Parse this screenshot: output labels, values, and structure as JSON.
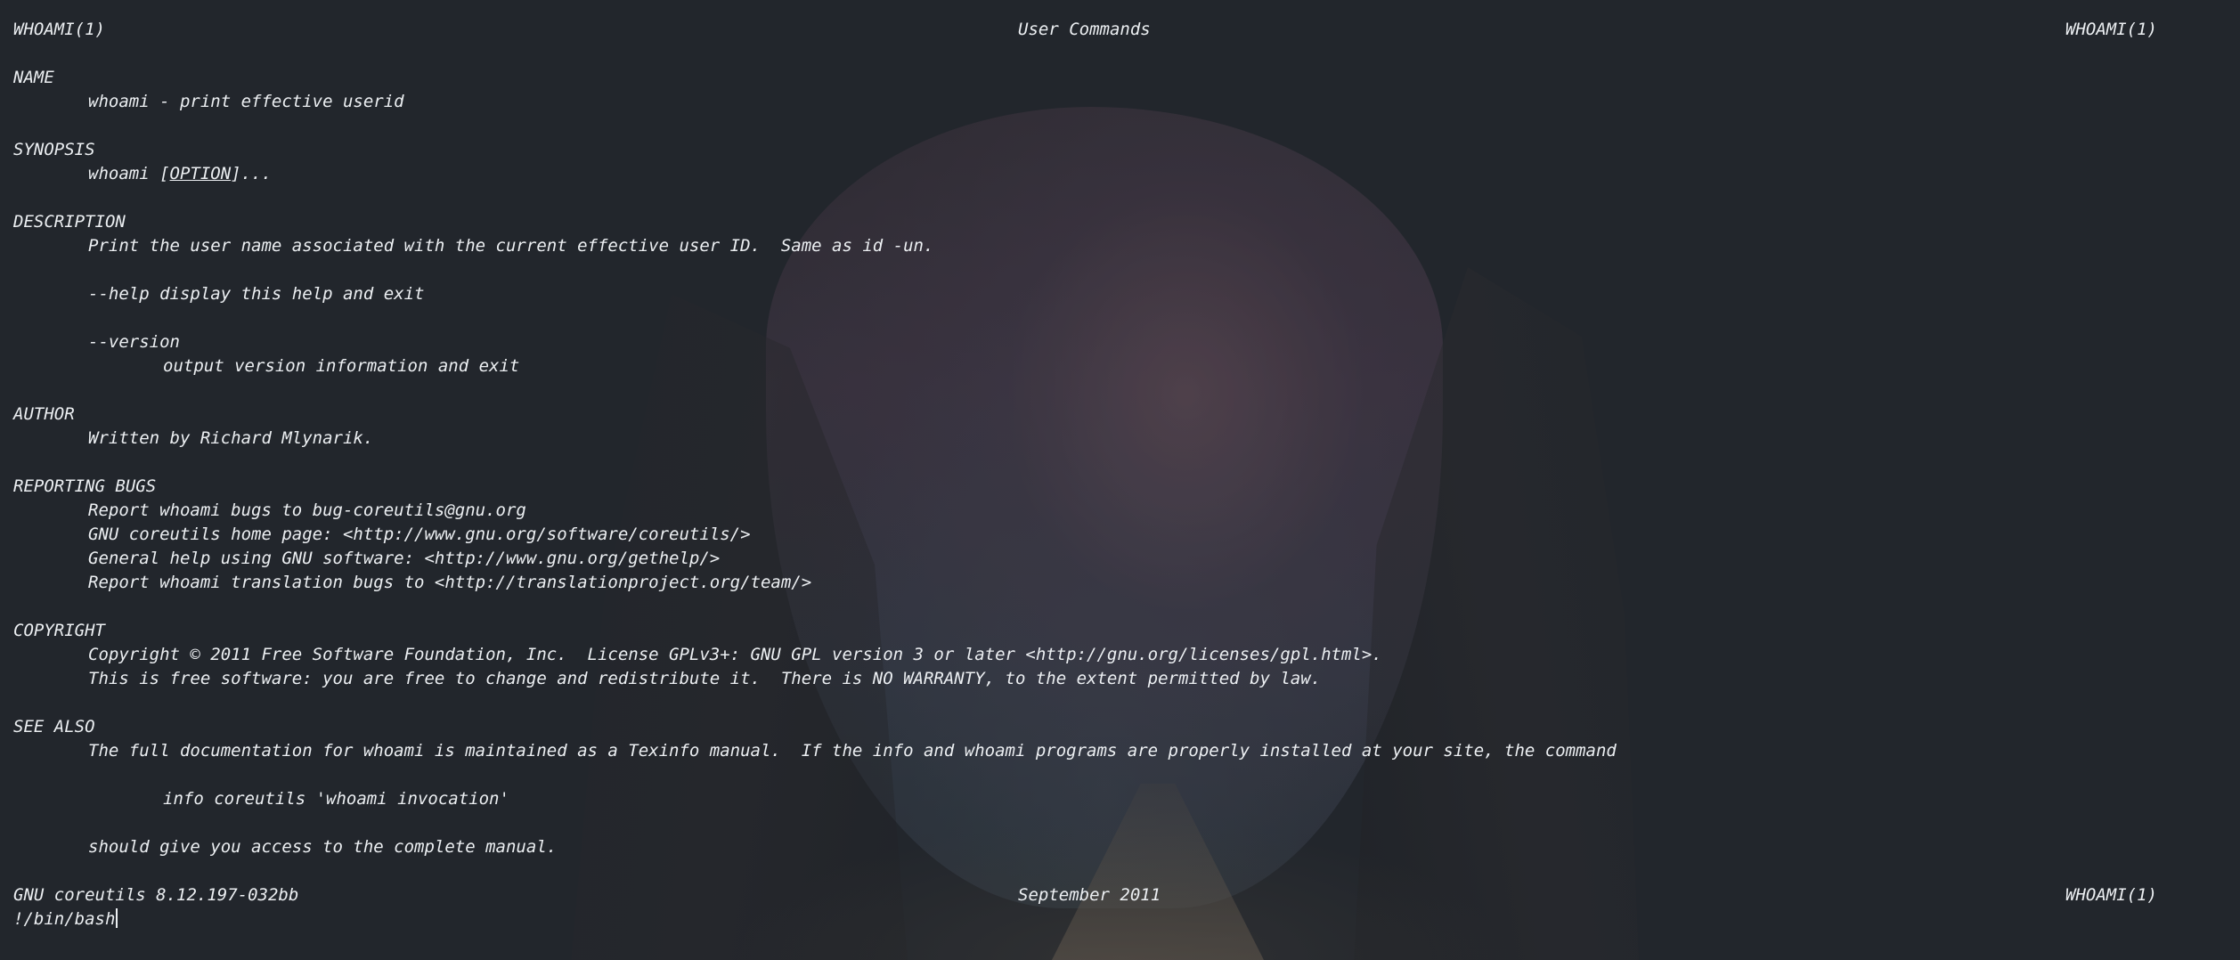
{
  "header": {
    "left": "WHOAMI(1)",
    "center": "User Commands",
    "right": "WHOAMI(1)"
  },
  "sections": {
    "name": {
      "heading": "NAME",
      "text": "whoami - print effective userid"
    },
    "synopsis": {
      "heading": "SYNOPSIS",
      "cmd": "whoami [",
      "option": "OPTION",
      "rest": "]..."
    },
    "description": {
      "heading": "DESCRIPTION",
      "text": "Print the user name associated with the current effective user ID.  Same as id -un.",
      "help": "--help display this help and exit",
      "version_flag": "--version",
      "version_desc": "output version information and exit"
    },
    "author": {
      "heading": "AUTHOR",
      "text": "Written by Richard Mlynarik."
    },
    "reporting_bugs": {
      "heading": "REPORTING BUGS",
      "lines": [
        "Report whoami bugs to bug-coreutils@gnu.org",
        "GNU coreutils home page: <http://www.gnu.org/software/coreutils/>",
        "General help using GNU software: <http://www.gnu.org/gethelp/>",
        "Report whoami translation bugs to <http://translationproject.org/team/>"
      ]
    },
    "copyright": {
      "heading": "COPYRIGHT",
      "lines": [
        "Copyright © 2011 Free Software Foundation, Inc.  License GPLv3+: GNU GPL version 3 or later <http://gnu.org/licenses/gpl.html>.",
        "This is free software: you are free to change and redistribute it.  There is NO WARRANTY, to the extent permitted by law."
      ]
    },
    "see_also": {
      "heading": "SEE ALSO",
      "text": "The full documentation for whoami is maintained as a Texinfo manual.  If the info and whoami programs are properly installed at your site, the command",
      "command": "info coreutils 'whoami invocation'",
      "closing": "should give you access to the complete manual."
    }
  },
  "footer": {
    "left": "GNU coreutils 8.12.197-032bb",
    "center": "September 2011",
    "right": "WHOAMI(1)"
  },
  "prompt": {
    "text": "!/bin/bash"
  }
}
